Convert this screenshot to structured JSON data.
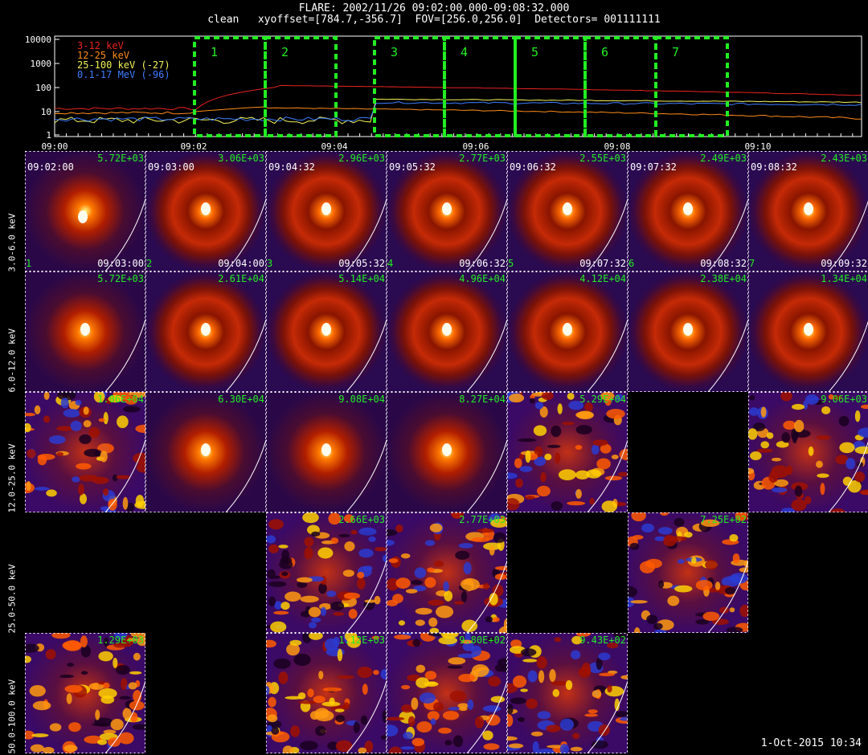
{
  "header": {
    "line1": "FLARE: 2002/11/26 09:02:00.000-09:08:32.000",
    "line2": "clean   xyoffset=[784.7,-356.7]  FOV=[256.0,256.0]  Detectors= 001111111"
  },
  "lightcurve": {
    "y_ticks": [
      "10000",
      "1000",
      "100",
      "10",
      "1"
    ],
    "x_ticks": [
      "09:00",
      "09:02",
      "09:04",
      "09:06",
      "09:08",
      "09:10"
    ],
    "legend": [
      {
        "label": "3-12 keV",
        "color": "#e8231f"
      },
      {
        "label": "12-25 keV",
        "color": "#ff8c1a"
      },
      {
        "label": "25-100 keV (-27)",
        "color": "#f2f25a"
      },
      {
        "label": "0.1-17 MeV (-96)",
        "color": "#3d7dff"
      }
    ],
    "intervals": [
      "1",
      "2",
      "3",
      "4",
      "5",
      "6",
      "7"
    ],
    "interval_color": "#22ee22"
  },
  "rows": [
    {
      "label": "3.0-6.0 keV",
      "panels": [
        {
          "peak": "5.72E+03",
          "start": "09:02:00",
          "end": "09:03:00",
          "idx": "1"
        },
        {
          "peak": "3.06E+03",
          "start": "09:03:00",
          "end": "09:04:00",
          "idx": "2"
        },
        {
          "peak": "2.96E+03",
          "start": "09:04:32",
          "end": "09:05:32",
          "idx": "3"
        },
        {
          "peak": "2.77E+03",
          "start": "09:05:32",
          "end": "09:06:32",
          "idx": "4"
        },
        {
          "peak": "2.55E+03",
          "start": "09:06:32",
          "end": "09:07:32",
          "idx": "5"
        },
        {
          "peak": "2.49E+03",
          "start": "09:07:32",
          "end": "09:08:32",
          "idx": "6"
        },
        {
          "peak": "2.43E+03",
          "start": "09:08:32",
          "end": "09:09:32",
          "idx": "7"
        }
      ]
    },
    {
      "label": "6.0-12.0 keV",
      "panels": [
        {
          "peak": "5.72E+03"
        },
        {
          "peak": "2.61E+04"
        },
        {
          "peak": "5.14E+04"
        },
        {
          "peak": "4.96E+04"
        },
        {
          "peak": "4.12E+04"
        },
        {
          "peak": "2.38E+04"
        },
        {
          "peak": "1.34E+04"
        }
      ]
    },
    {
      "label": "12.0-25.0 keV",
      "panels": [
        {
          "peak": "1.06E+04"
        },
        {
          "peak": "6.30E+04"
        },
        {
          "peak": "9.08E+04"
        },
        {
          "peak": "8.27E+04"
        },
        {
          "peak": "5.29E+04"
        },
        null,
        {
          "peak": "9.06E+03"
        }
      ]
    },
    {
      "label": "25.0-50.0 keV",
      "panels": [
        null,
        null,
        {
          "peak": "2.66E+03"
        },
        {
          "peak": "2.77E+03"
        },
        null,
        {
          "peak": "7.25E+02"
        },
        null
      ]
    },
    {
      "label": "50.0-100.0 keV",
      "panels": [
        {
          "peak": "1.29E+03"
        },
        null,
        {
          "peak": "1.12E+03"
        },
        {
          "peak": "9.80E+02"
        },
        {
          "peak": "9.43E+02"
        },
        null,
        null
      ]
    }
  ],
  "footer": {
    "timestamp": "1-Oct-2015 10:34"
  }
}
